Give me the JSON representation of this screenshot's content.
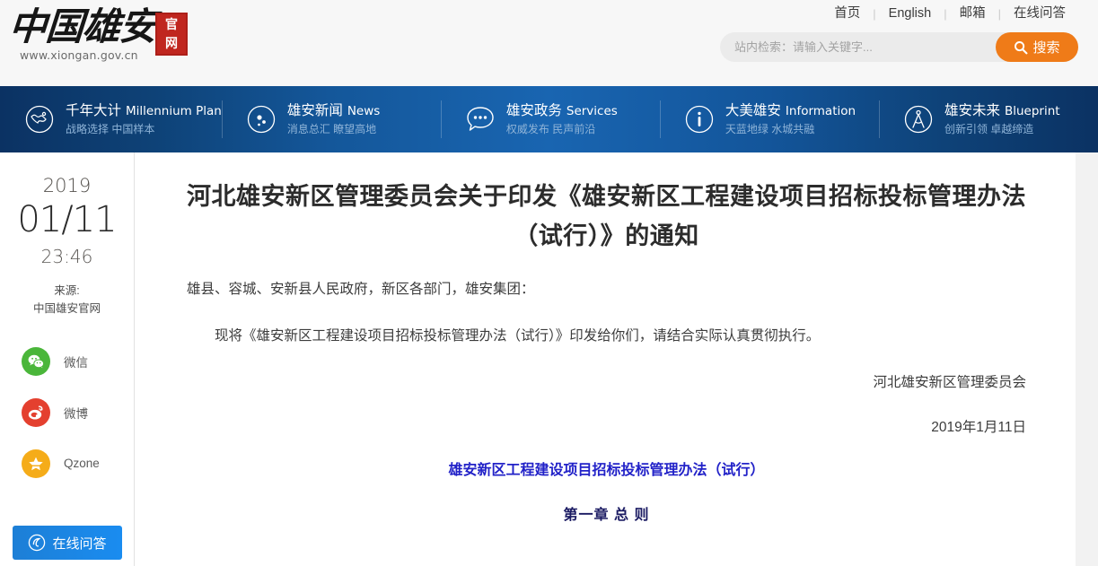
{
  "site": {
    "logo_text": "中国雄安",
    "logo_url": "www.xiongan.gov.cn",
    "seal_line1": "官",
    "seal_line2": "网"
  },
  "top_links": [
    {
      "label": "首页"
    },
    {
      "label": "English"
    },
    {
      "label": "邮箱"
    },
    {
      "label": "在线问答"
    }
  ],
  "search": {
    "placeholder": "站内检索：请输入关键字...",
    "value": "",
    "button_label": "搜索",
    "button_color": "#ef7b18",
    "icon": "search-icon"
  },
  "nav": {
    "background_start": "#0b3263",
    "background_mid": "#1965b1",
    "items": [
      {
        "icon": "globe-icon",
        "title_cn": "千年大计",
        "title_en": "Millennium Plan",
        "subtitle": "战略选择 中国样本"
      },
      {
        "icon": "news-circle-icon",
        "title_cn": "雄安新闻",
        "title_en": "News",
        "subtitle": "消息总汇 瞭望高地"
      },
      {
        "icon": "speech-bubble-icon",
        "title_cn": "雄安政务",
        "title_en": "Services",
        "subtitle": "权威发布 民声前沿"
      },
      {
        "icon": "info-circle-icon",
        "title_cn": "大美雄安",
        "title_en": "Information",
        "subtitle": "天蓝地绿 水城共融"
      },
      {
        "icon": "compass-icon",
        "title_cn": "雄安未来",
        "title_en": "Blueprint",
        "subtitle": "创新引领 卓越缔造"
      }
    ]
  },
  "sidebar": {
    "year": "2019",
    "day": "01/11",
    "time": "23:46",
    "source_label": "来源:",
    "source_name": "中国雄安官网",
    "share": [
      {
        "icon": "wechat-icon",
        "label": "微信",
        "color": "#4ab63a"
      },
      {
        "icon": "weibo-icon",
        "label": "微博",
        "color": "#e4402f"
      },
      {
        "icon": "qzone-icon",
        "label": "Qzone",
        "color": "#f5ac19"
      }
    ],
    "ask_button": {
      "label": "在线问答",
      "icon": "headset-icon",
      "color": "#1a86e6"
    }
  },
  "article": {
    "title": "河北雄安新区管理委员会关于印发《雄安新区工程建设项目招标投标管理办法（试行）》的通知",
    "paragraphs": [
      {
        "text": "雄县、容城、安新县人民政府，新区各部门，雄安集团：",
        "style": "plain"
      },
      {
        "text": "现将《雄安新区工程建设项目招标投标管理办法（试行）》印发给你们，请结合实际认真贯彻执行。",
        "style": "indent"
      },
      {
        "text": "河北雄安新区管理委员会",
        "style": "right"
      },
      {
        "text": "2019年1月11日",
        "style": "right"
      }
    ],
    "regulation_title": "雄安新区工程建设项目招标投标管理办法（试行）",
    "regulation_title_color": "#2222c8",
    "chapter_heading": "第一章 总 则",
    "chapter_heading_color": "#1b1b63"
  }
}
